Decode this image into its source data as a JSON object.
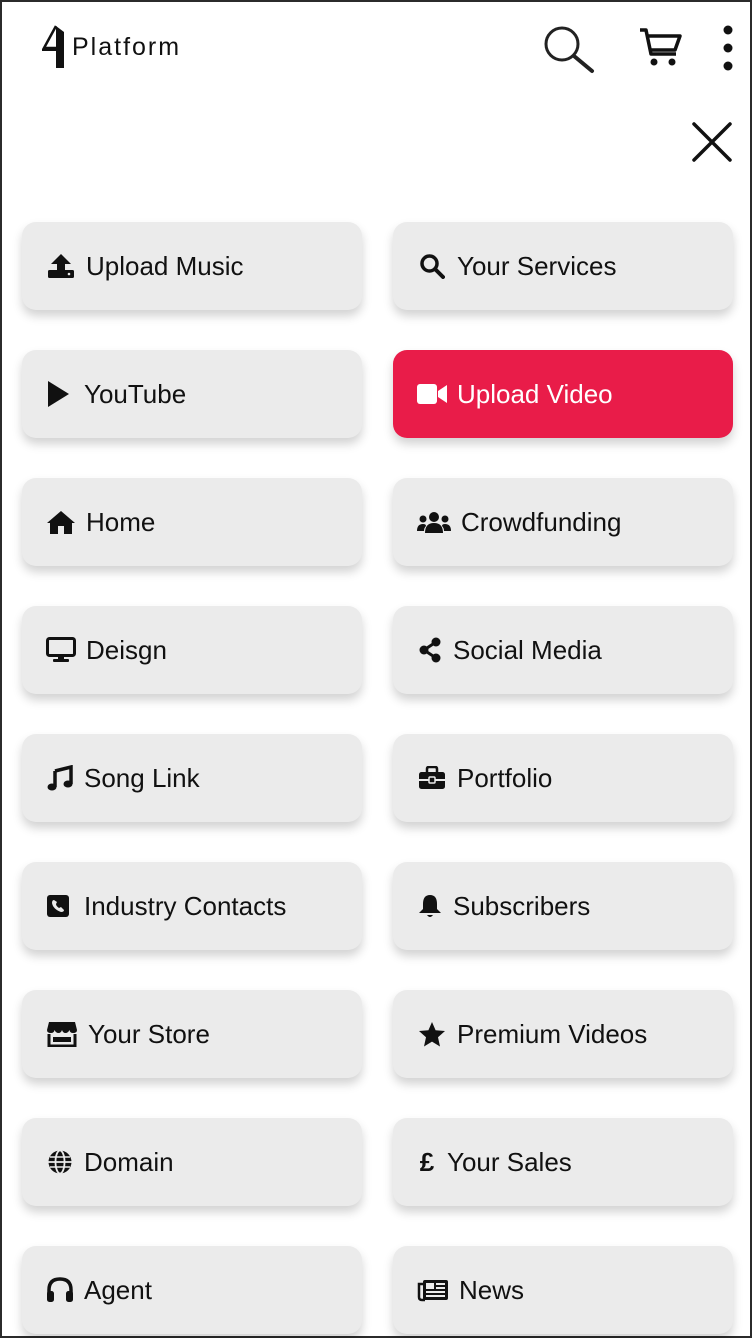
{
  "header": {
    "logo_text": "Platform",
    "logo_icon": "stylized-4-logo",
    "search_icon": "search-icon",
    "cart_icon": "cart-icon",
    "menu_icon": "more-vertical-icon"
  },
  "close_icon": "close-icon",
  "colors": {
    "tile_bg": "#ebebeb",
    "active_bg": "#e91c49",
    "active_text": "#ffffff"
  },
  "menu": {
    "active": "Upload Video",
    "items": [
      {
        "label": "Upload Music",
        "icon": "upload-icon"
      },
      {
        "label": "Your Services",
        "icon": "search-icon"
      },
      {
        "label": "YouTube",
        "icon": "play-icon"
      },
      {
        "label": "Upload Video",
        "icon": "video-camera-icon"
      },
      {
        "label": "Home",
        "icon": "home-icon"
      },
      {
        "label": "Crowdfunding",
        "icon": "users-icon"
      },
      {
        "label": "Deisgn",
        "icon": "desktop-icon"
      },
      {
        "label": "Social Media",
        "icon": "share-icon"
      },
      {
        "label": "Song Link",
        "icon": "music-note-icon"
      },
      {
        "label": "Portfolio",
        "icon": "briefcase-icon"
      },
      {
        "label": "Industry Contacts",
        "icon": "phone-square-icon"
      },
      {
        "label": "Subscribers",
        "icon": "bell-icon"
      },
      {
        "label": "Your Store",
        "icon": "store-icon"
      },
      {
        "label": "Premium Videos",
        "icon": "star-icon"
      },
      {
        "label": "Domain",
        "icon": "globe-icon"
      },
      {
        "label": "Your Sales",
        "icon": "pound-icon",
        "glyph": "£"
      },
      {
        "label": "Agent",
        "icon": "headphones-icon"
      },
      {
        "label": "News",
        "icon": "newspaper-icon"
      }
    ]
  }
}
